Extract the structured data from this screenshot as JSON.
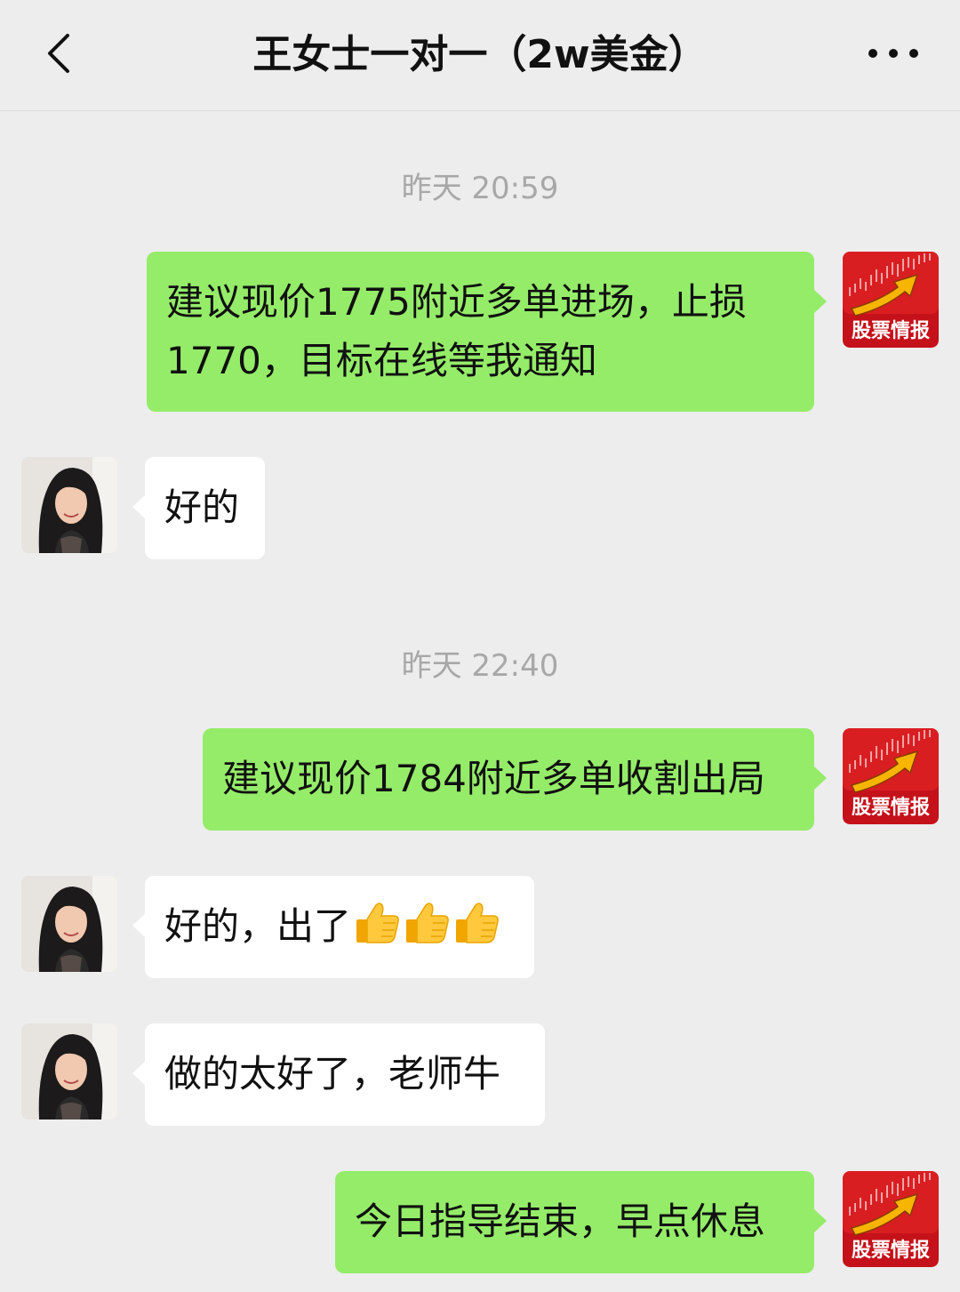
{
  "header": {
    "title": "王女士一对一（2w美金）",
    "back_icon": "chevron-left-icon",
    "more_icon": "more-dots-icon"
  },
  "brand_avatar": {
    "label": "股票情报",
    "colors": {
      "bg": "#c5111a",
      "arrow": "#f7b500"
    }
  },
  "colors": {
    "outgoing_bubble": "#95ec69",
    "incoming_bubble": "#ffffff",
    "background": "#ededed",
    "timestamp": "#a8a8a8"
  },
  "messages": [
    {
      "type": "timestamp",
      "text": "昨天 20:59"
    },
    {
      "type": "outgoing",
      "text": "建议现价1775附近多单进场，止损1770，目标在线等我通知"
    },
    {
      "type": "incoming",
      "text": "好的"
    },
    {
      "type": "timestamp",
      "text": "昨天 22:40"
    },
    {
      "type": "outgoing",
      "text": "建议现价1784附近多单收割出局"
    },
    {
      "type": "incoming",
      "text": "好的，出了",
      "emoji": [
        "thumbs-up-icon",
        "thumbs-up-icon",
        "thumbs-up-icon"
      ]
    },
    {
      "type": "incoming",
      "text": "做的太好了，老师牛"
    },
    {
      "type": "outgoing",
      "text": "今日指导结束，早点休息"
    }
  ]
}
